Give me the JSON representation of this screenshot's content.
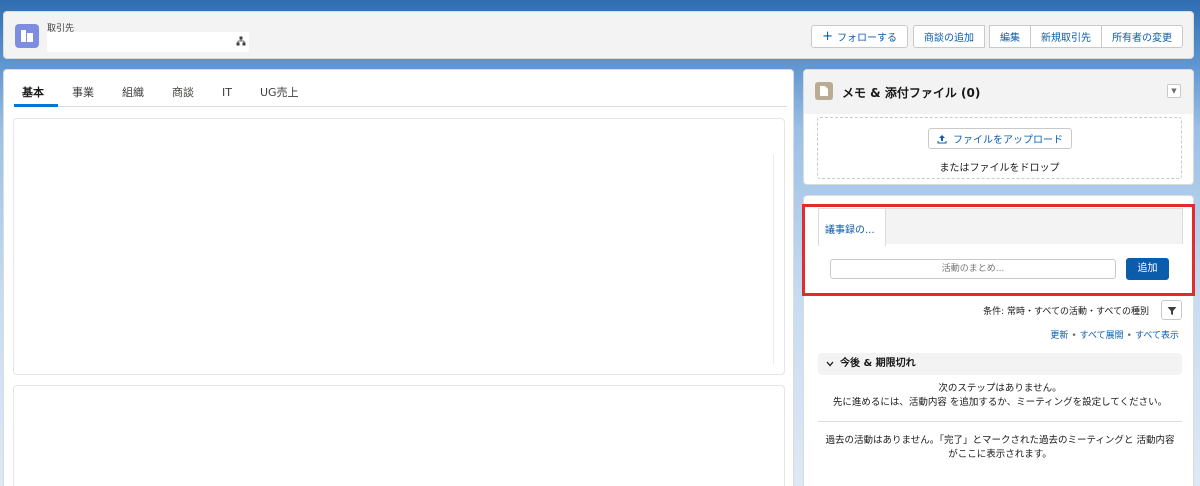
{
  "header": {
    "record_type": "取引先",
    "record_name": "",
    "buttons": {
      "follow": "フォローする",
      "add_opportunity": "商談の追加",
      "edit": "編集",
      "new_account": "新規取引先",
      "change_owner": "所有者の変更"
    }
  },
  "tabs": [
    "基本",
    "事業",
    "組織",
    "商談",
    "IT",
    "UG売上"
  ],
  "active_tab": "基本",
  "files": {
    "title": "メモ & 添付ファイル (0)",
    "upload_label": "ファイルをアップロード",
    "drop_text": "またはファイルをドロップ"
  },
  "activity": {
    "tab_label": "議事録の...",
    "summary_placeholder": "活動のまとめ...",
    "add_label": "追加",
    "filter_text": "条件: 常時・すべての活動・すべての種別",
    "links": [
      "更新",
      "すべて展開",
      "すべて表示"
    ],
    "section_title": "今後 & 期限切れ",
    "no_steps_line1": "次のステップはありません。",
    "no_steps_line2": "先に進めるには、活動内容 を追加するか、ミーティングを設定してください。",
    "no_past_line1": "過去の活動はありません。「完了」とマークされた過去のミーティングと 活動内容",
    "no_past_line2": "がここに表示されます。"
  },
  "colors": {
    "brand": "#0b5cab",
    "active_tab_underline": "#0176d3",
    "highlight": "#e42a2a",
    "record_icon": "#7f8de1",
    "files_icon": "#baac93"
  }
}
